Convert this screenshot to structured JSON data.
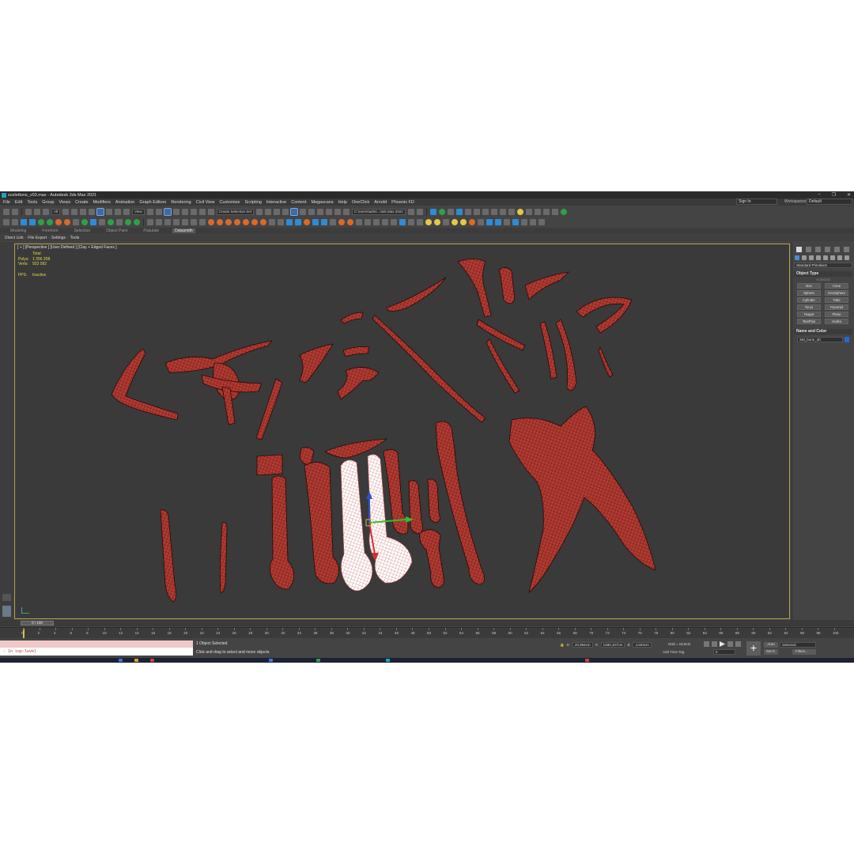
{
  "window": {
    "title": "scelettons_v03.max - Autodesk 3ds Max 2021",
    "controls": [
      "–",
      "❐",
      "✕"
    ]
  },
  "menu": [
    "File",
    "Edit",
    "Tools",
    "Group",
    "Views",
    "Create",
    "Modifiers",
    "Animation",
    "Graph Editors",
    "Rendering",
    "Civil View",
    "Customize",
    "Scripting",
    "Interactive",
    "Content",
    "Megascans",
    "Help",
    "OneClick",
    "Arnold",
    "Phoenix FD"
  ],
  "account": {
    "signin": "Sign In",
    "workspaces_label": "Workspaces:",
    "workspace": "Default"
  },
  "toolbar": {
    "filter": "All",
    "view": "View",
    "selection_set": "Create Selection Set",
    "project_path": "C:\\Users\\adml...\\3ds Max 2021"
  },
  "ribbon": {
    "tabs": [
      "Modeling",
      "Freeform",
      "Selection",
      "Object Paint",
      "Populate",
      "Datasmith"
    ],
    "active_tab": "Datasmith"
  },
  "quickbar": [
    "Direct Link",
    "·",
    "File Export",
    "·",
    "Settings",
    "·",
    "Tools"
  ],
  "viewport": {
    "label": "[ + ] [Perspective ] [User Defined ] [Clay + Edged Faces ]",
    "stats": {
      "total_label": "Total",
      "polys_label": "Polys:",
      "polys": "1 356 208",
      "verts_label": "Verts:",
      "verts": "923 092",
      "fps_label": "FPS:",
      "fps": "Inactive"
    }
  },
  "command_panel": {
    "dropdown": "Standard Primitives",
    "object_type": {
      "title": "Object Type",
      "autogrid": "AutoGrid",
      "buttons": [
        "Box",
        "Cone",
        "Sphere",
        "GeoSphere",
        "Cylinder",
        "Tube",
        "Torus",
        "Pyramid",
        "Teapot",
        "Plane",
        "TextPlus",
        "Hedra"
      ]
    },
    "name_and_color": {
      "title": "Name and Color",
      "name": "SM_bone_40",
      "color": "#1f6ad4"
    }
  },
  "timeline": {
    "slider": "0 / 100",
    "ticks": [
      "0",
      "2",
      "4",
      "6",
      "8",
      "10",
      "12",
      "14",
      "16",
      "18",
      "20",
      "22",
      "24",
      "26",
      "28",
      "30",
      "32",
      "34",
      "36",
      "38",
      "40",
      "42",
      "44",
      "46",
      "48",
      "50",
      "52",
      "54",
      "56",
      "58",
      "60",
      "62",
      "64",
      "66",
      "68",
      "70",
      "72",
      "74",
      "76",
      "78",
      "80",
      "82",
      "84",
      "86",
      "88",
      "90",
      "92",
      "94",
      "96",
      "98",
      "100"
    ]
  },
  "status": {
    "maxscript": "- In top-level",
    "selection": "1 Object Selected",
    "prompt": "Click and drag to select and move objects",
    "x_label": "X:",
    "x": "20,994cm",
    "y_label": "Y:",
    "y": "1480,107cm",
    "z_label": "Z:",
    "z": "4,503cm",
    "grid": "Grid = 10,0cm",
    "add_time_tag": "Add Time Tag",
    "frame": "0",
    "auto": "Auto",
    "set_k": "Set K.",
    "selected": "Selected",
    "filters": "Filters..."
  },
  "colors": {
    "mesh": "#b33a32",
    "wire": "#3a0f0c",
    "selected_mesh": "#ffffff",
    "viewport_border": "#b8a24a",
    "stats_text": "#e8d84a"
  }
}
